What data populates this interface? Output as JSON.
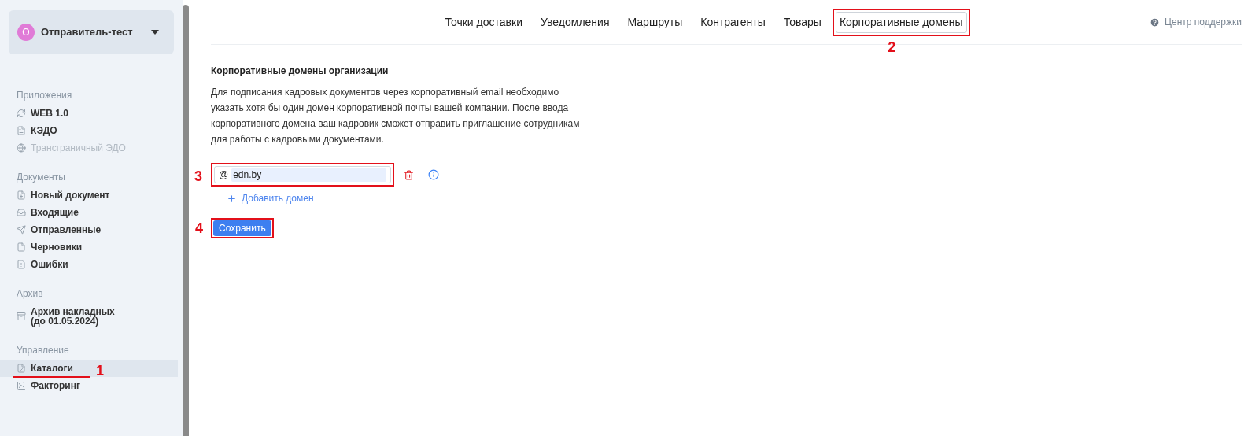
{
  "account": {
    "avatar": "О",
    "name": "Отправитель-тест"
  },
  "sidebar": {
    "sections": [
      {
        "title": "Приложения",
        "items": [
          {
            "label": "WEB 1.0",
            "disabled": false,
            "selected": false
          },
          {
            "label": "КЭДО",
            "disabled": false,
            "selected": false
          },
          {
            "label": "Трансграничный ЭДО",
            "disabled": true,
            "selected": false
          }
        ]
      },
      {
        "title": "Документы",
        "items": [
          {
            "label": "Новый документ",
            "disabled": false,
            "selected": false
          },
          {
            "label": "Входящие",
            "disabled": false,
            "selected": false
          },
          {
            "label": "Отправленные",
            "disabled": false,
            "selected": false
          },
          {
            "label": "Черновики",
            "disabled": false,
            "selected": false
          },
          {
            "label": "Ошибки",
            "disabled": false,
            "selected": false
          }
        ]
      },
      {
        "title": "Архив",
        "items": [
          {
            "label": "Архив накладных\n(до 01.05.2024)",
            "disabled": false,
            "selected": false
          }
        ]
      },
      {
        "title": "Управление",
        "items": [
          {
            "label": "Каталоги",
            "disabled": false,
            "selected": true,
            "callout": "1"
          },
          {
            "label": "Факторинг",
            "disabled": false,
            "selected": false
          }
        ]
      }
    ]
  },
  "tabs": [
    {
      "label": "Точки доставки",
      "selected": false
    },
    {
      "label": "Уведомления",
      "selected": false
    },
    {
      "label": "Маршруты",
      "selected": false
    },
    {
      "label": "Контрагенты",
      "selected": false
    },
    {
      "label": "Товары",
      "selected": false
    },
    {
      "label": "Корпоративные домены",
      "selected": true,
      "callout": "2"
    }
  ],
  "support_link": "Центр поддержки",
  "section": {
    "title": "Корпоративные домены организации",
    "description": "Для подписания кадровых документов через корпоративный email необходимо указать хотя бы один домен корпоративной почты вашей компании. После ввода корпоративного домена ваш кадровик сможет отправить приглашение сотрудникам для работы с кадровыми документами."
  },
  "domains": [
    {
      "prefix": "@",
      "value": "edn.by",
      "callout": "3"
    }
  ],
  "add_domain": "Добавить домен",
  "save_button": {
    "label": "Сохранить",
    "callout": "4"
  }
}
